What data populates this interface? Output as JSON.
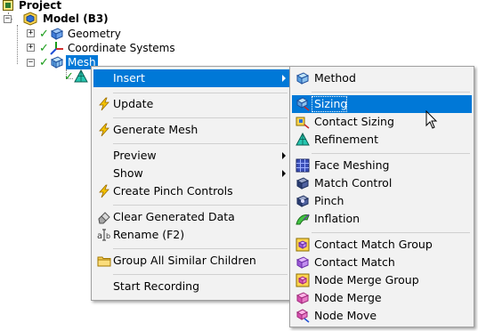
{
  "tree": {
    "project": "Project",
    "model": "Model (B3)",
    "geometry": "Geometry",
    "coordinate_systems": "Coordinate Systems",
    "mesh": "Mesh",
    "expand_collapsed": "+",
    "expand_open": "−"
  },
  "context_menu": {
    "insert": "Insert",
    "update": "Update",
    "generate_mesh": "Generate Mesh",
    "preview": "Preview",
    "show": "Show",
    "create_pinch_controls": "Create Pinch Controls",
    "clear_generated_data": "Clear Generated Data",
    "rename": "Rename (F2)",
    "group_all_similar_children": "Group All Similar Children",
    "start_recording": "Start Recording"
  },
  "submenu": {
    "method": "Method",
    "sizing": "Sizing",
    "contact_sizing": "Contact Sizing",
    "refinement": "Refinement",
    "face_meshing": "Face Meshing",
    "match_control": "Match Control",
    "pinch": "Pinch",
    "inflation": "Inflation",
    "contact_match_group": "Contact Match Group",
    "contact_match": "Contact Match",
    "node_merge_group": "Node Merge Group",
    "node_merge": "Node Merge",
    "node_move": "Node Move"
  },
  "colors": {
    "selection": "#0078d7",
    "menu_bg": "#f2f2f2",
    "check_green": "#1a9c1a",
    "lightning_yellow": "#f5c400"
  }
}
